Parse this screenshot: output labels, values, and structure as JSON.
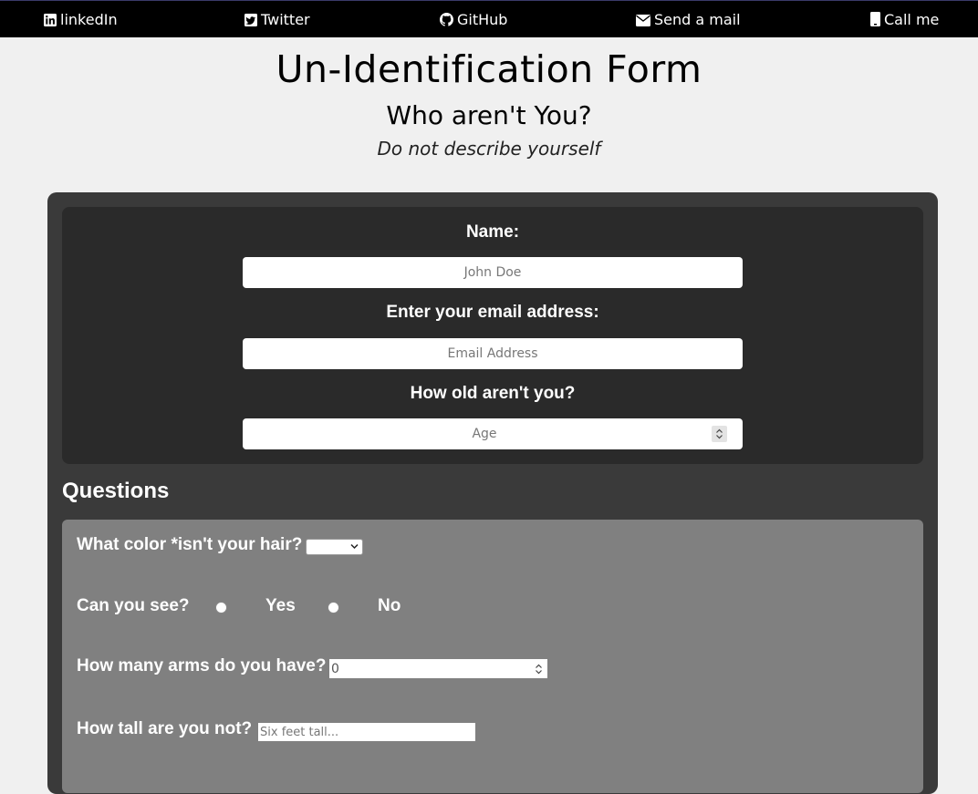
{
  "nav": {
    "items": [
      {
        "label": "linkedIn",
        "icon": "linkedin-icon"
      },
      {
        "label": "Twitter",
        "icon": "twitter-icon"
      },
      {
        "label": "GitHub",
        "icon": "github-icon"
      },
      {
        "label": "Send a mail",
        "icon": "envelope-icon"
      },
      {
        "label": "Call me",
        "icon": "phone-icon"
      }
    ]
  },
  "header": {
    "title": "Un-Identification Form",
    "subtitle": "Who aren't You?",
    "tagline": "Do not describe yourself"
  },
  "identity": {
    "name_label": "Name:",
    "name_placeholder": "John Doe",
    "email_label": "Enter your email address:",
    "email_placeholder": "Email Address",
    "age_label": "How old aren't you?",
    "age_placeholder": "Age"
  },
  "questions": {
    "heading": "Questions",
    "hair_label": "What color *isn't your hair?",
    "hair_selected": "",
    "see_label": "Can you see?",
    "see_options": [
      "Yes",
      "No"
    ],
    "arms_label": "How many arms do you have?",
    "arms_value": "0",
    "tall_label": "How tall are you not?",
    "tall_placeholder": "Six feet tall..."
  },
  "colors": {
    "nav_bg": "#000000",
    "page_bg": "#f0f0f0",
    "form_bg": "#3a3a3a",
    "identity_bg": "#2a2a2a",
    "questions_bg": "#808080"
  }
}
